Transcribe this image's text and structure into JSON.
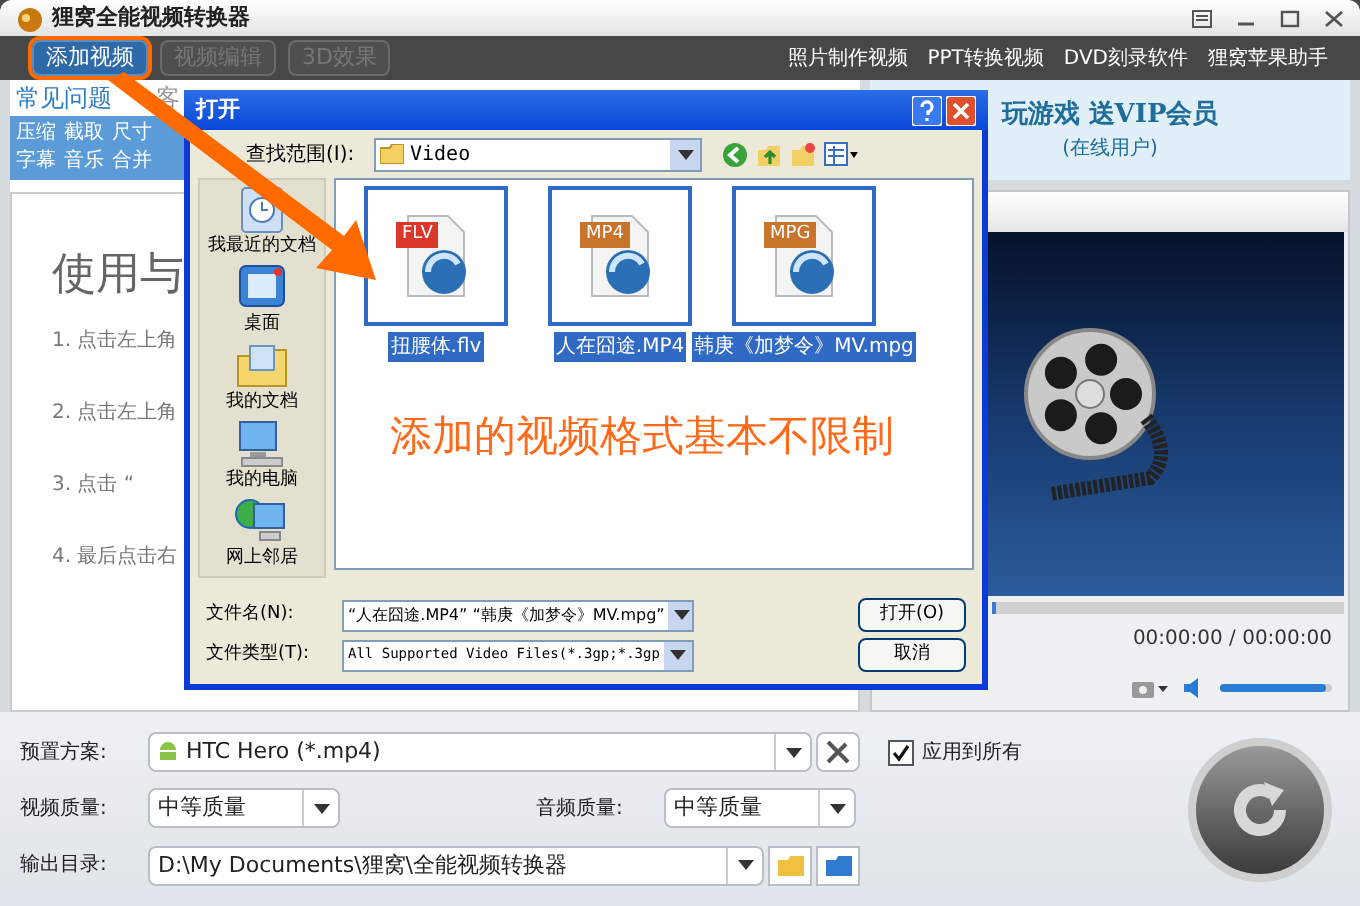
{
  "window": {
    "title": "狸窝全能视频转换器"
  },
  "toolbar": {
    "buttons": [
      {
        "label": "添加视频",
        "disabled": false,
        "highlighted": true
      },
      {
        "label": "视频编辑",
        "disabled": true,
        "highlighted": false
      },
      {
        "label": "3D效果",
        "disabled": true,
        "highlighted": false
      }
    ],
    "links": [
      "照片制作视频",
      "PPT转换视频",
      "DVD刻录软件",
      "狸窝苹果助手"
    ]
  },
  "help_panel": {
    "tabs": [
      {
        "label": "常见问题",
        "selected": true
      },
      {
        "label": "客",
        "selected": false
      }
    ],
    "tags": [
      [
        "压缩",
        "截取",
        "尺寸"
      ],
      [
        "字幕",
        "音乐",
        "合并"
      ]
    ],
    "heading": "使用与",
    "steps": [
      "1. 点击左上角",
      "2. 点击左上角",
      "3. 点击 “",
      "4. 最后点击右"
    ]
  },
  "promo": {
    "title": "玩游戏 送VIP会员",
    "subtitle": "(在线用户)"
  },
  "player": {
    "progress": {
      "level": 0
    },
    "time": "00:00:00 / 00:00:00",
    "volume": {
      "level": 0.95
    }
  },
  "dialog": {
    "title": "打开",
    "look_in_label": "查找范围(I):",
    "look_in_value": "Video",
    "places": [
      {
        "label": "我最近的文档",
        "kind": "recent"
      },
      {
        "label": "桌面",
        "kind": "desktop"
      },
      {
        "label": "我的文档",
        "kind": "documents"
      },
      {
        "label": "我的电脑",
        "kind": "computer"
      },
      {
        "label": "网上邻居",
        "kind": "network"
      }
    ],
    "files": [
      {
        "name": "扭腰体.flv",
        "badge": "FLV",
        "color": "#d9382b",
        "selected": true
      },
      {
        "name": "人在囧途.MP4",
        "badge": "MP4",
        "color": "#c8742a",
        "selected": true
      },
      {
        "name": "韩庚《加梦令》MV.mpg",
        "badge": "MPG",
        "color": "#c8742a",
        "selected": true
      }
    ],
    "filename_label": "文件名(N):",
    "filename_value": "“人在囧途.MP4” “韩庚《加梦令》MV.mpg”",
    "filetype_label": "文件类型(T):",
    "filetype_value": "All Supported Video Files(*.3gp;*.3gp",
    "buttons": [
      "打开(O)",
      "取消"
    ]
  },
  "annotation": {
    "text": "添加的视频格式基本不限制"
  },
  "settings": {
    "preset_label": "预置方案:",
    "preset_value": "HTC Hero (*.mp4)",
    "apply_all": {
      "label": "应用到所有",
      "checked": true
    },
    "video_quality_label": "视频质量:",
    "video_quality_value": "中等质量",
    "audio_quality_label": "音频质量:",
    "audio_quality_value": "中等质量",
    "output_label": "输出目录:",
    "output_value": "D:\\My Documents\\狸窝\\全能视频转换器"
  }
}
